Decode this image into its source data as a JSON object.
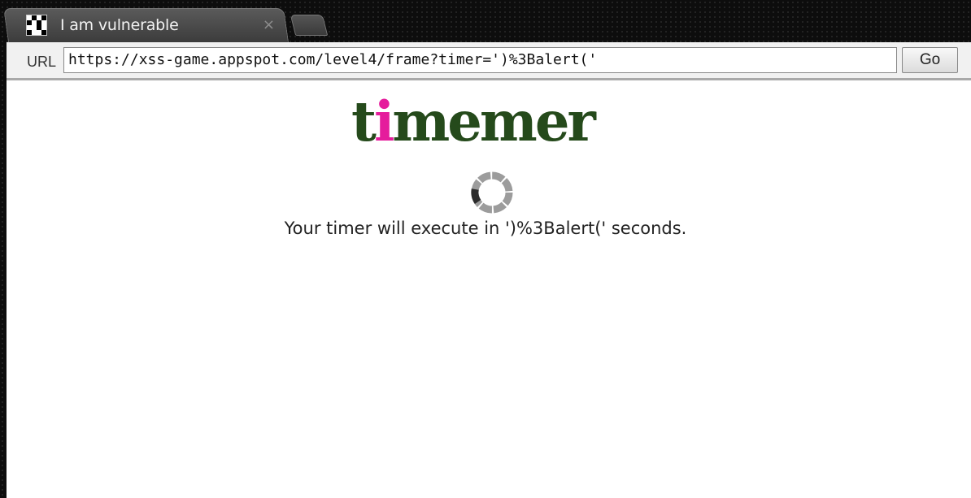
{
  "tab": {
    "title": "I am vulnerable",
    "close_glyph": "×"
  },
  "toolbar": {
    "url_label": "URL",
    "url_value": "https://xss-game.appspot.com/level4/frame?timer=')%3Balert('",
    "go_label": "Go"
  },
  "page": {
    "logo_first": "t",
    "logo_accent": "i",
    "logo_rest": "memer",
    "message": "Your timer will execute in ')%3Balert(' seconds."
  },
  "colors": {
    "logo_green": "#254a1b",
    "logo_pink": "#e51c9c"
  },
  "icons": {
    "favicon": "checkered-favicon-icon",
    "spinner": "loading-spinner-icon"
  }
}
